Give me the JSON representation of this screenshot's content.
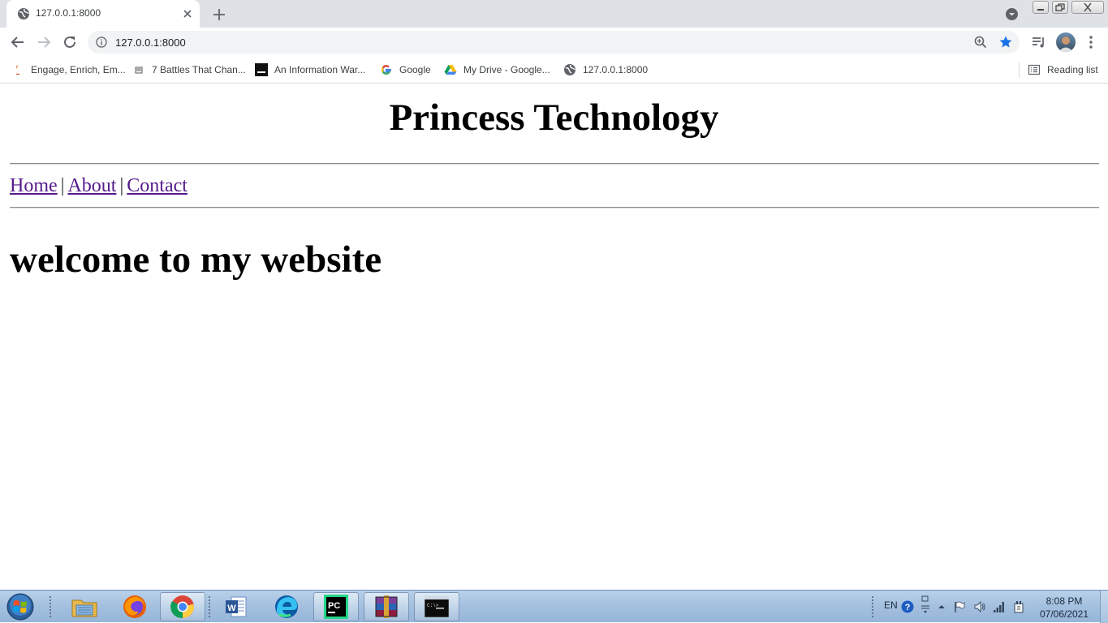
{
  "browser": {
    "tab": {
      "title": "127.0.0.1:8000"
    },
    "address_bar": {
      "url": "127.0.0.1:8000"
    },
    "colors": {
      "star": "#1a73e8",
      "tab_strip": "#dee1e6",
      "link_visited": "#551a8b"
    },
    "bookmarks": [
      {
        "label": "Engage, Enrich, Em...",
        "icon": "music-note-icon"
      },
      {
        "label": "7 Battles That Chan...",
        "icon": "generic-site-icon"
      },
      {
        "label": "An Information War...",
        "icon": "black-square-icon"
      },
      {
        "label": "Google",
        "icon": "google-g-icon"
      },
      {
        "label": "My Drive - Google...",
        "icon": "google-drive-icon"
      },
      {
        "label": "127.0.0.1:8000",
        "icon": "globe-icon"
      }
    ],
    "reading_list": "Reading list"
  },
  "page": {
    "title": "Princess Technology",
    "nav": [
      {
        "label": "Home"
      },
      {
        "label": "About"
      },
      {
        "label": "Contact"
      }
    ],
    "nav_separator": "|",
    "heading": "welcome to my website"
  },
  "taskbar": {
    "apps": [
      {
        "name": "file-explorer-icon"
      },
      {
        "name": "firefox-icon"
      },
      {
        "name": "chrome-icon"
      },
      {
        "name": "word-icon"
      },
      {
        "name": "edge-icon"
      },
      {
        "name": "pycharm-icon"
      },
      {
        "name": "winrar-icon"
      },
      {
        "name": "cmd-icon"
      }
    ],
    "language": "EN",
    "clock": {
      "time": "8:08 PM",
      "date": "07/06/2021"
    }
  }
}
